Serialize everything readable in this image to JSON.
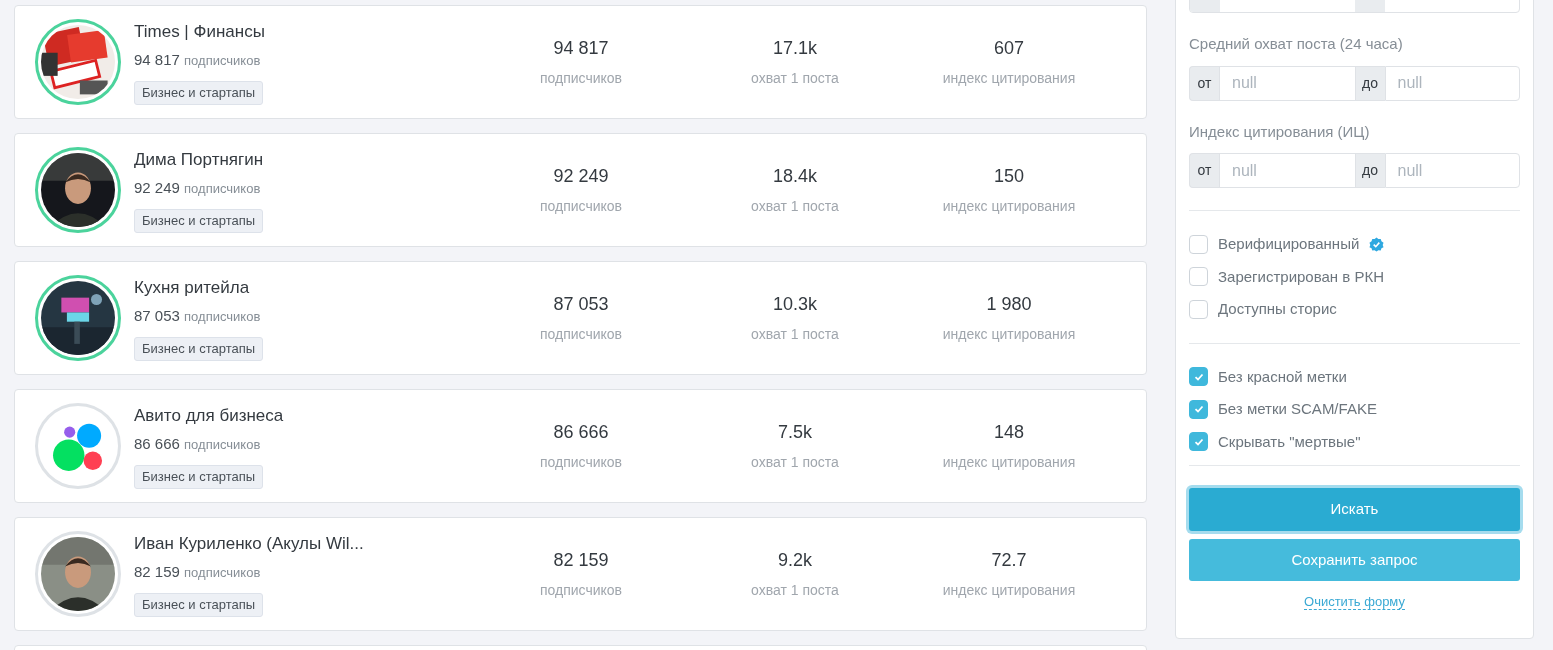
{
  "channels": [
    {
      "name": "Times | Финансы",
      "subscribers": "94 817",
      "subscribers_unit": "подписчиков",
      "tag": "Бизнес и стартапы",
      "ring_highlighted": true,
      "stats": [
        {
          "value": "94 817",
          "label": "подписчиков"
        },
        {
          "value": "17.1k",
          "label": "охват 1 поста"
        },
        {
          "value": "607",
          "label": "индекс цитирования"
        }
      ]
    },
    {
      "name": "Дима Портнягин",
      "subscribers": "92 249",
      "subscribers_unit": "подписчиков",
      "tag": "Бизнес и стартапы",
      "ring_highlighted": true,
      "avatar": {
        "kind": "person",
        "color": "#15171c"
      },
      "stats": [
        {
          "value": "92 249",
          "label": "подписчиков"
        },
        {
          "value": "18.4k",
          "label": "охват 1 поста"
        },
        {
          "value": "150",
          "label": "индекс цитирования"
        }
      ]
    },
    {
      "name": "Кухня ритейла",
      "subscribers": "87 053",
      "subscribers_unit": "подписчиков",
      "tag": "Бизнес и стартапы",
      "ring_highlighted": true,
      "stats": [
        {
          "value": "87 053",
          "label": "подписчиков"
        },
        {
          "value": "10.3k",
          "label": "охват 1 поста"
        },
        {
          "value": "1 980",
          "label": "индекс цитирования"
        }
      ]
    },
    {
      "name": "Авито для бизнеса",
      "subscribers": "86 666",
      "subscribers_unit": "подписчиков",
      "tag": "Бизнес и стартапы",
      "ring_highlighted": false,
      "avatar": {
        "kind": "logo"
      },
      "stats": [
        {
          "value": "86 666",
          "label": "подписчиков"
        },
        {
          "value": "7.5k",
          "label": "охват 1 поста"
        },
        {
          "value": "148",
          "label": "индекс цитирования"
        }
      ]
    },
    {
      "name": "Иван Куриленко (Акулы Wil...",
      "subscribers": "82 159",
      "subscribers_unit": "подписчиков",
      "tag": "Бизнес и стартапы",
      "ring_highlighted": false,
      "avatar": {
        "kind": "person",
        "color": "#8a8f86"
      },
      "stats": [
        {
          "value": "82 159",
          "label": "подписчиков"
        },
        {
          "value": "9.2k",
          "label": "охват 1 поста"
        },
        {
          "value": "72.7",
          "label": "индекс цитирования"
        }
      ]
    }
  ],
  "filters": {
    "ranges": [
      {
        "label": "Средний охват поста (24 часа)",
        "from_prefix": "от",
        "from_placeholder": "null",
        "to_prefix": "до",
        "to_placeholder": "null"
      },
      {
        "label": "Индекс цитирования (ИЦ)",
        "from_prefix": "от",
        "from_placeholder": "null",
        "to_prefix": "до",
        "to_placeholder": "null"
      }
    ],
    "checkbox_groups": [
      [
        {
          "label": "Верифицированный",
          "checked": false,
          "verified_badge": true
        },
        {
          "label": "Зарегистрирован в РКН",
          "checked": false
        },
        {
          "label": "Доступны сторис",
          "checked": false
        }
      ],
      [
        {
          "label": "Без красной метки",
          "checked": true
        },
        {
          "label": "Без метки SCAM/FAKE",
          "checked": true
        },
        {
          "label": "Скрывать \"мертвые\"",
          "checked": true
        }
      ]
    ],
    "search_button": "Искать",
    "save_button": "Сохранить запрос",
    "clear_link": "Очистить форму"
  }
}
